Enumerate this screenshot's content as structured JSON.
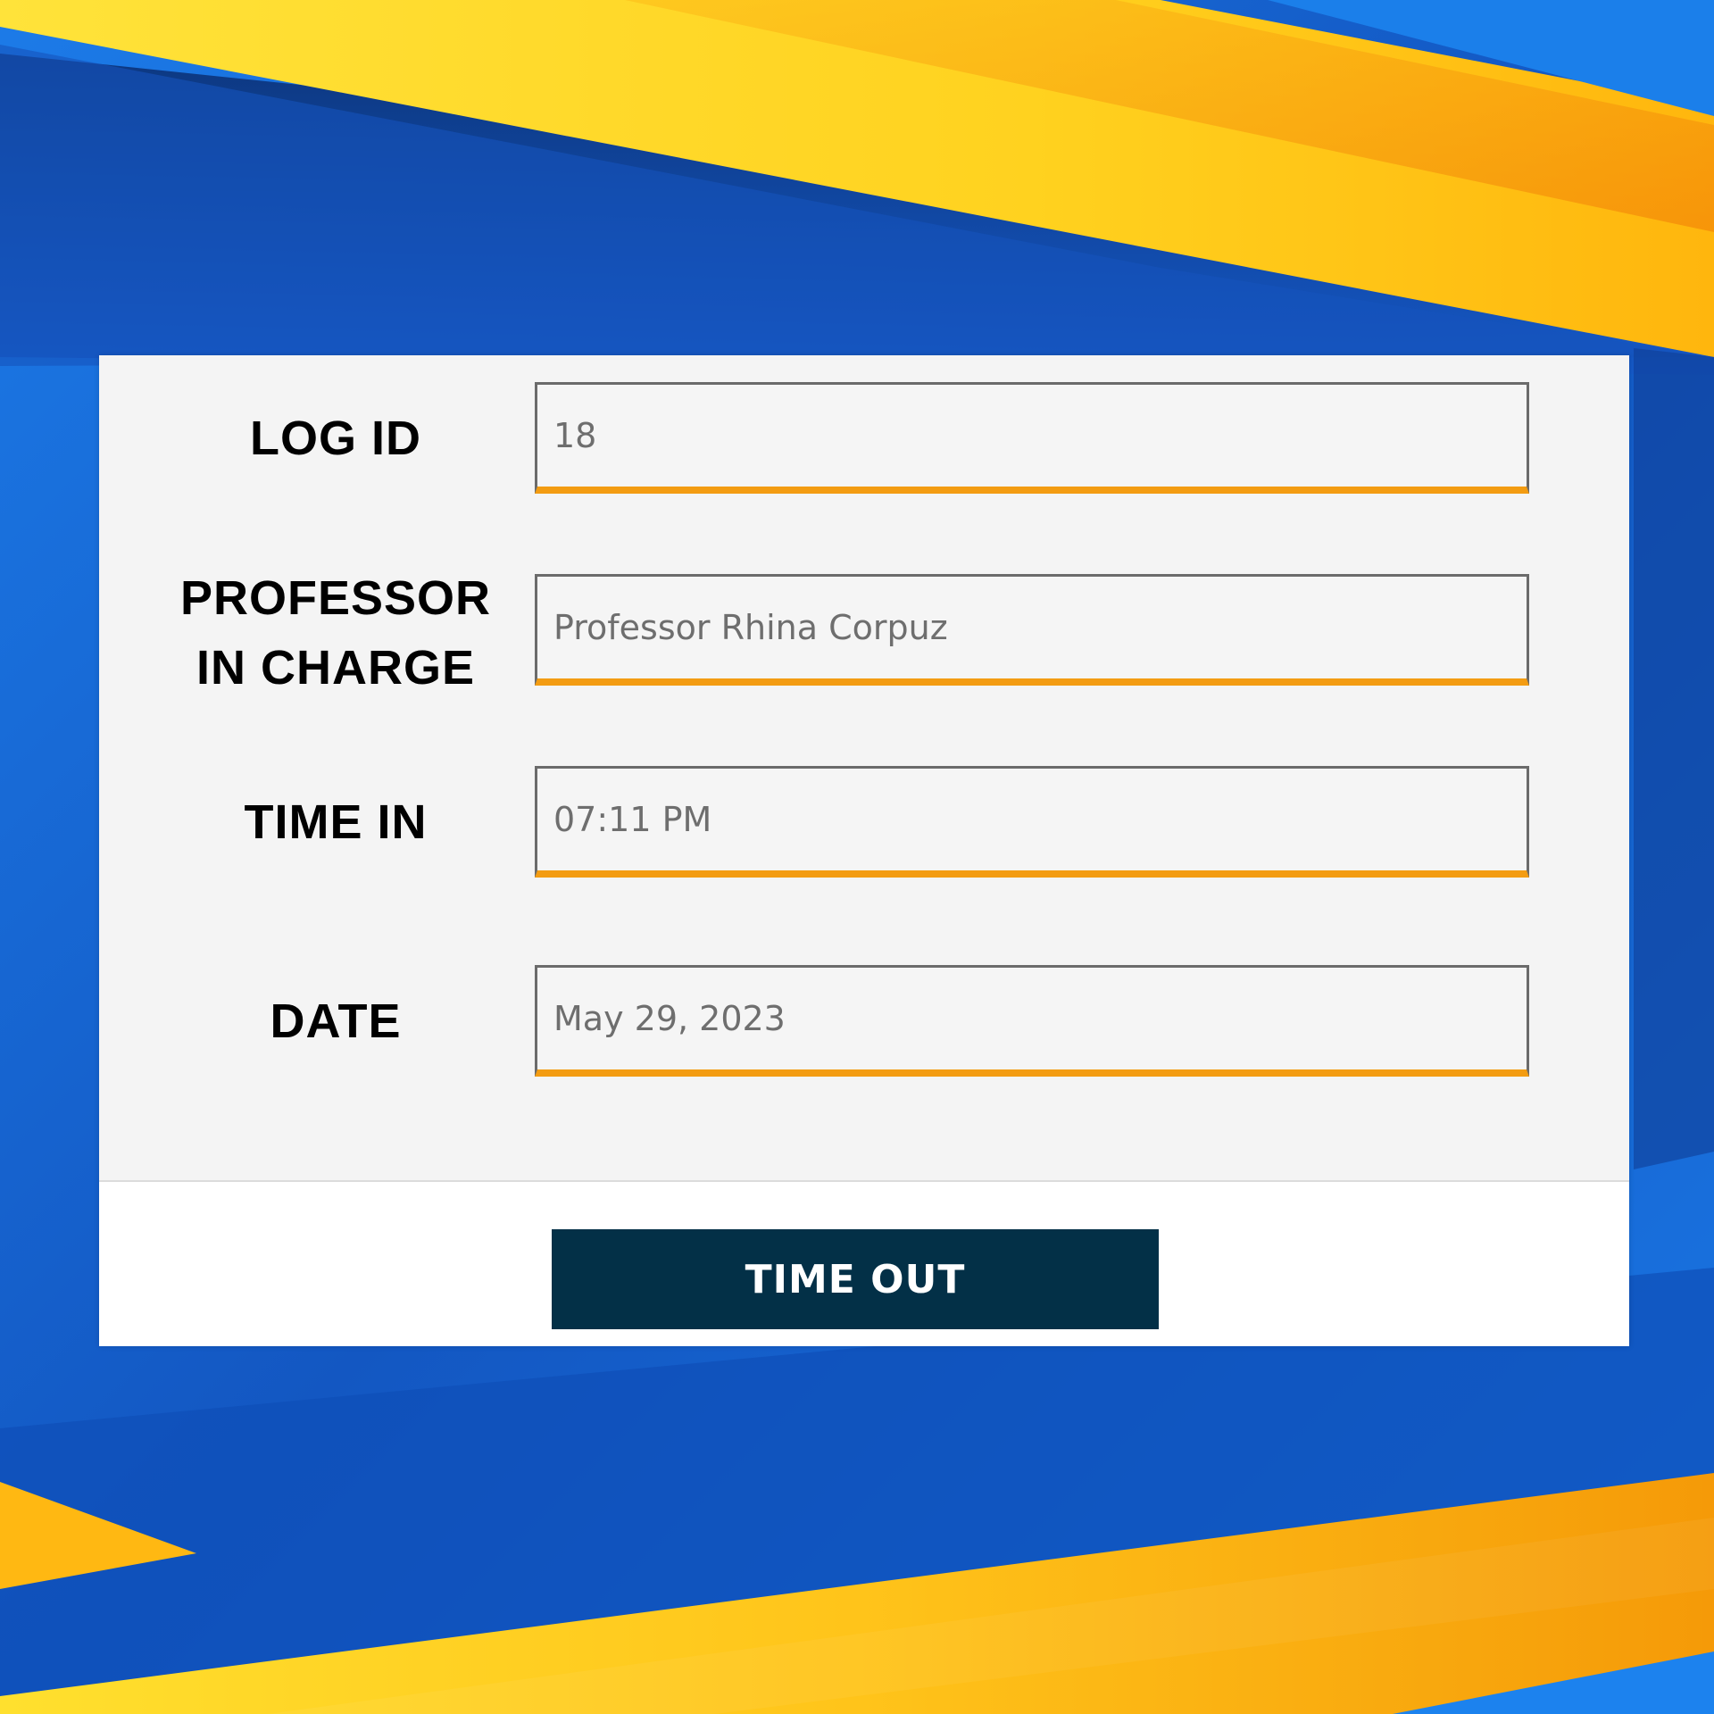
{
  "colors": {
    "blue": "#1565d8",
    "dark_blue": "#0a3a8c",
    "yellow": "#ffd21f",
    "orange": "#f39c12",
    "form_bg": "#f4f4f4",
    "button_bg": "#033047",
    "underline": "#f39c12"
  },
  "form": {
    "fields": [
      {
        "label_lines": [
          "LOG ID"
        ],
        "value": "18"
      },
      {
        "label_lines": [
          "PROFESSOR",
          "IN CHARGE"
        ],
        "value": "Professor Rhina Corpuz"
      },
      {
        "label_lines": [
          "TIME IN"
        ],
        "value": "07:11 PM"
      },
      {
        "label_lines": [
          "DATE"
        ],
        "value": "May 29, 2023"
      }
    ]
  },
  "footer": {
    "button_label": "TIME OUT"
  }
}
